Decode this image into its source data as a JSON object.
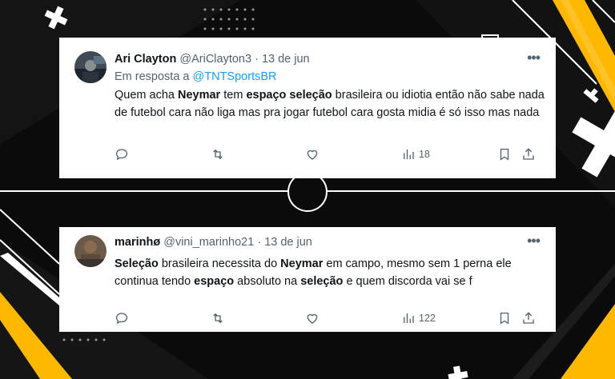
{
  "colors": {
    "accent": "#1d9bf0",
    "yellow": "#ffb800",
    "background": "#0b0b0b"
  },
  "tweets": [
    {
      "name": "Ari Clayton",
      "handle": "@AriClayton3",
      "sep": "·",
      "date": "13 de jun",
      "more": "•••",
      "reply_prefix": "Em resposta a",
      "reply_mention": "@TNTSportsBR",
      "segments": [
        {
          "t": "Quem acha ",
          "b": false
        },
        {
          "t": "Neymar",
          "b": true
        },
        {
          "t": " tem ",
          "b": false
        },
        {
          "t": "espaço seleção",
          "b": true
        },
        {
          "t": " brasileira ou idiotia então não sabe nada de futebol cara não liga mas pra jogar futebol cara gosta midia é só isso mas nada",
          "b": false
        }
      ],
      "views": "18",
      "icons": [
        "reply-icon",
        "retweet-icon",
        "like-icon",
        "views-icon",
        "bookmark-icon",
        "share-icon"
      ]
    },
    {
      "name": "marinhø",
      "handle": "@vini_marinho21",
      "sep": "·",
      "date": "13 de jun",
      "more": "•••",
      "segments": [
        {
          "t": "Seleção",
          "b": true
        },
        {
          "t": " brasileira necessita do ",
          "b": false
        },
        {
          "t": "Neymar",
          "b": true
        },
        {
          "t": " em campo, mesmo sem 1 perna ele continua tendo ",
          "b": false
        },
        {
          "t": "espaço",
          "b": true
        },
        {
          "t": " absoluto na ",
          "b": false
        },
        {
          "t": "seleção",
          "b": true
        },
        {
          "t": " e quem discorda vai se f",
          "b": false
        }
      ],
      "views": "122",
      "icons": [
        "reply-icon",
        "retweet-icon",
        "like-icon",
        "views-icon",
        "bookmark-icon",
        "share-icon"
      ]
    }
  ]
}
